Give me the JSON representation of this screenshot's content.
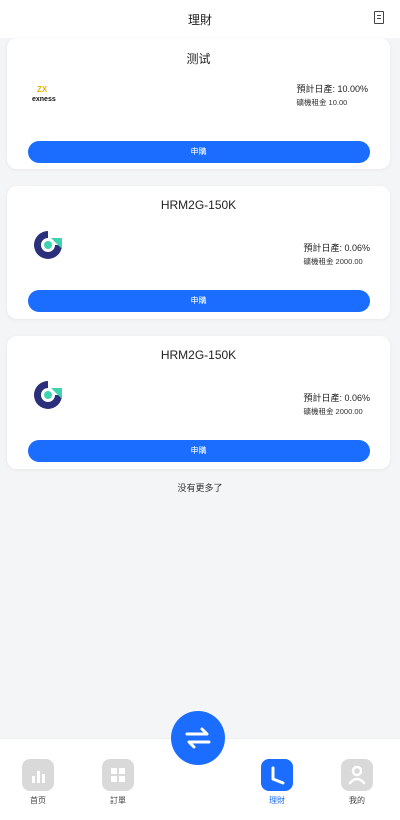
{
  "header": {
    "title": "理財"
  },
  "products": [
    {
      "name": "测试",
      "logo_text": "exness",
      "daily_rate": "預計日產: 10.00%",
      "min_amount": "礦機租金 10.00",
      "button": "申購"
    },
    {
      "name": "HRM2G-150K",
      "logo_text": "",
      "daily_rate": "預計日產: 0.06%",
      "min_amount": "礦機租金 2000.00",
      "button": "申購"
    },
    {
      "name": "HRM2G-150K",
      "logo_text": "",
      "daily_rate": "預計日產: 0.06%",
      "min_amount": "礦機租金 2000.00",
      "button": "申購"
    }
  ],
  "footer_note": "没有更多了",
  "tabbar": {
    "items": [
      {
        "label": "首页",
        "icon": "chart-icon"
      },
      {
        "label": "訂單",
        "icon": "grid-icon"
      },
      {
        "label": "理財",
        "icon": "clock-icon"
      },
      {
        "label": "我的",
        "icon": "user-icon"
      }
    ],
    "center_icon": "swap-arrows-icon"
  },
  "colors": {
    "accent": "#1a6dff",
    "background": "#f4f5f7",
    "inactive_icon": "#d9d9d9"
  }
}
